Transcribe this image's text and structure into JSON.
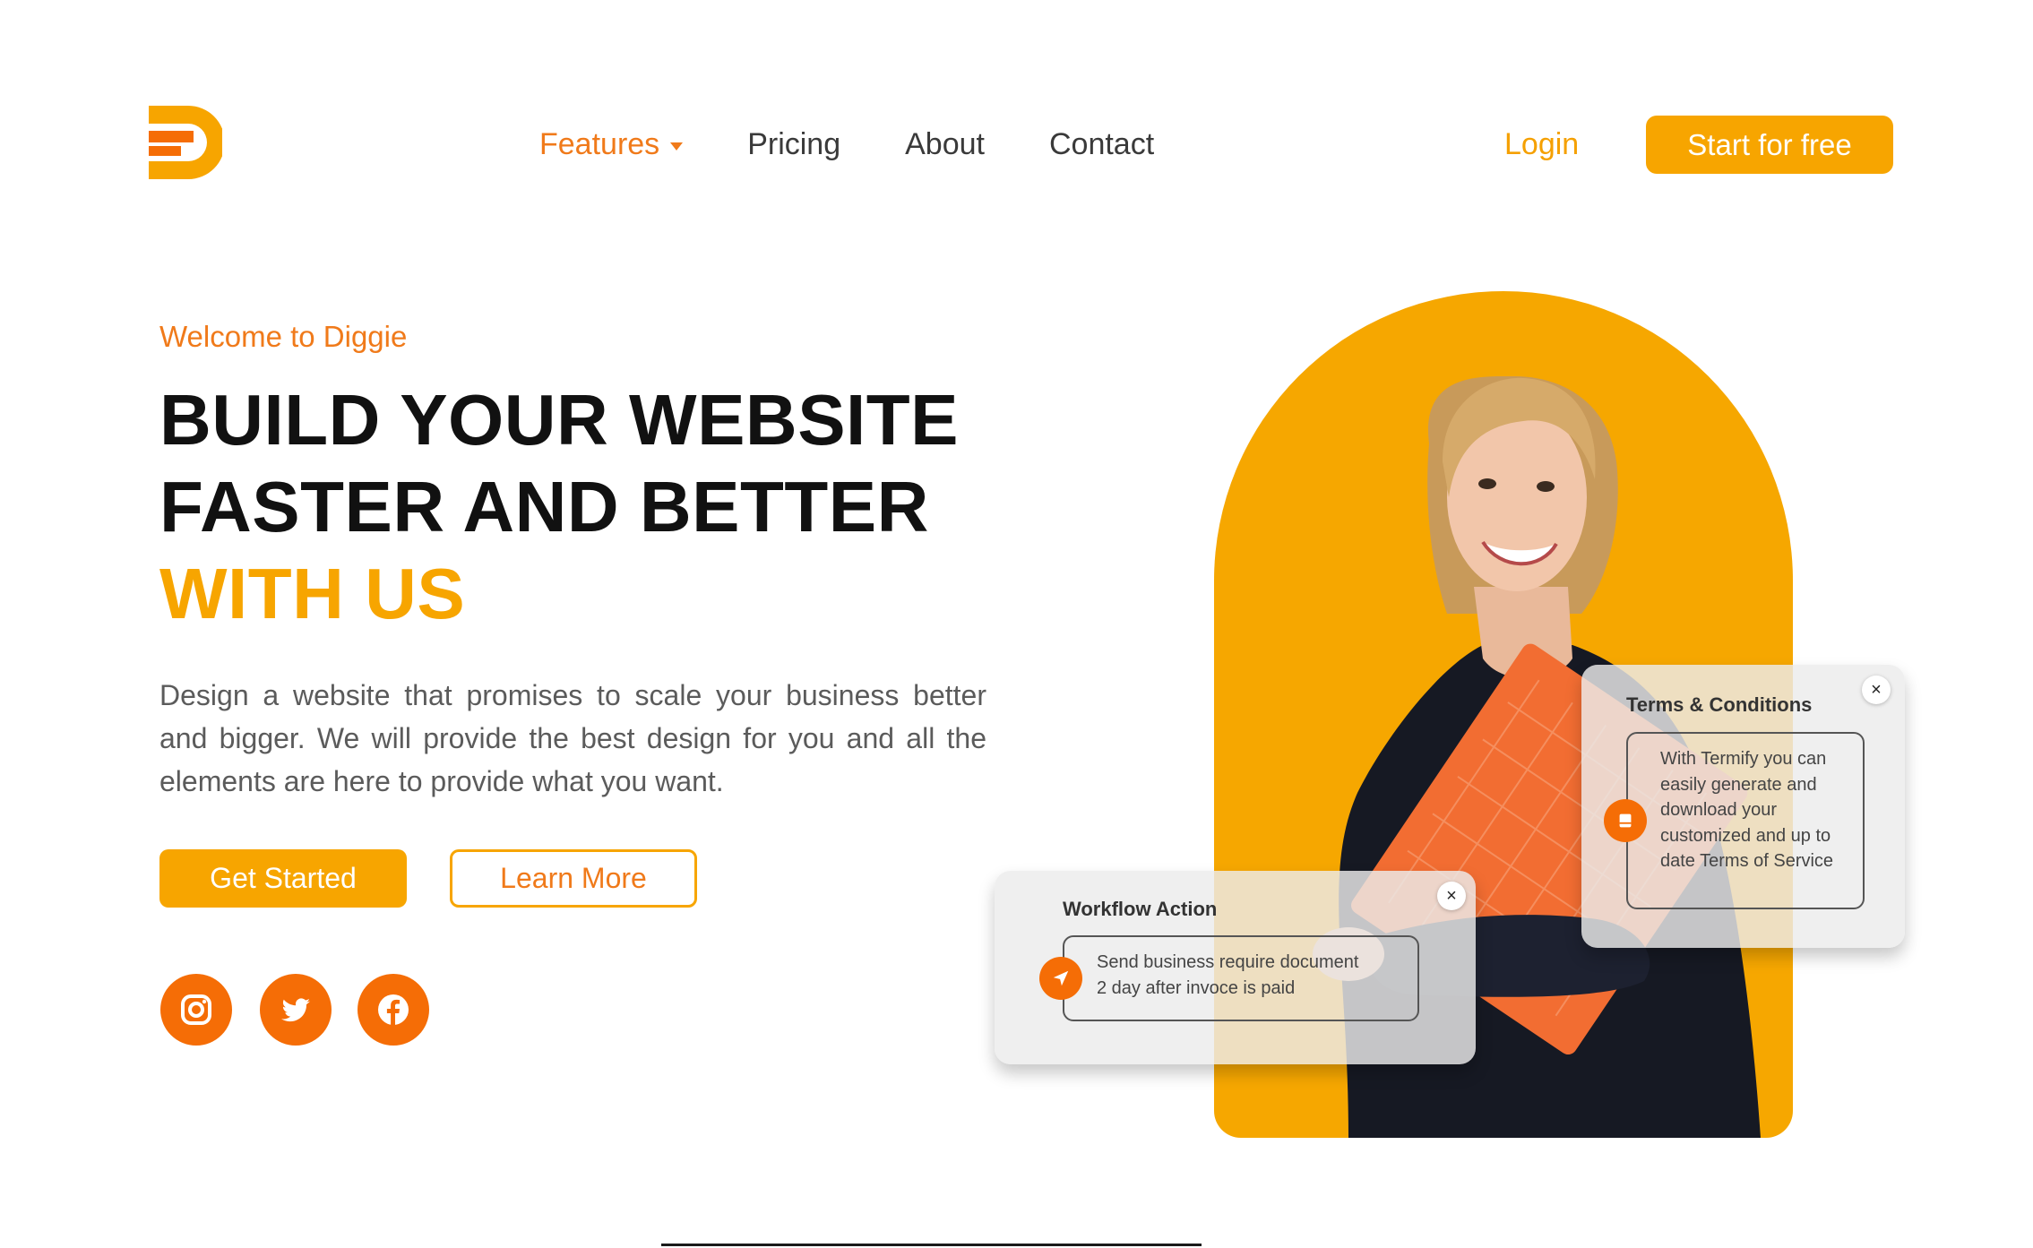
{
  "brand": {
    "logo_icon": "diggie-logo-icon",
    "primary_color": "#f7a500",
    "accent_color": "#f07a1a"
  },
  "nav": {
    "items": [
      {
        "label": "Features",
        "has_dropdown": true,
        "active": true
      },
      {
        "label": "Pricing"
      },
      {
        "label": "About"
      },
      {
        "label": "Contact"
      }
    ]
  },
  "header": {
    "login_label": "Login",
    "cta_label": "Start for free"
  },
  "hero": {
    "eyebrow": "Welcome to Diggie",
    "headline_line1": "BUILD YOUR WEBSITE",
    "headline_line2": "FASTER AND BETTER",
    "headline_line3": "WITH US",
    "description": "Design a website that promises to scale your business better and bigger. We will provide the best design for you and all the elements are here to provide what you want.",
    "primary_button": "Get Started",
    "secondary_button": "Learn More"
  },
  "social": [
    {
      "icon": "instagram-icon"
    },
    {
      "icon": "twitter-icon"
    },
    {
      "icon": "facebook-icon"
    }
  ],
  "cards": {
    "terms": {
      "title": "Terms & Conditions",
      "close": "×",
      "text_line1": "With Termify you can",
      "text_line2": "easily generate and",
      "text_line3": "download your",
      "text_line4": "customized and up to",
      "text_line5": "date Terms of Service",
      "icon": "document-icon"
    },
    "workflow": {
      "title": "Workflow Action",
      "close": "×",
      "text_line1": "Send business require document",
      "text_line2": "2 day after invoce is paid",
      "icon": "send-icon"
    }
  }
}
